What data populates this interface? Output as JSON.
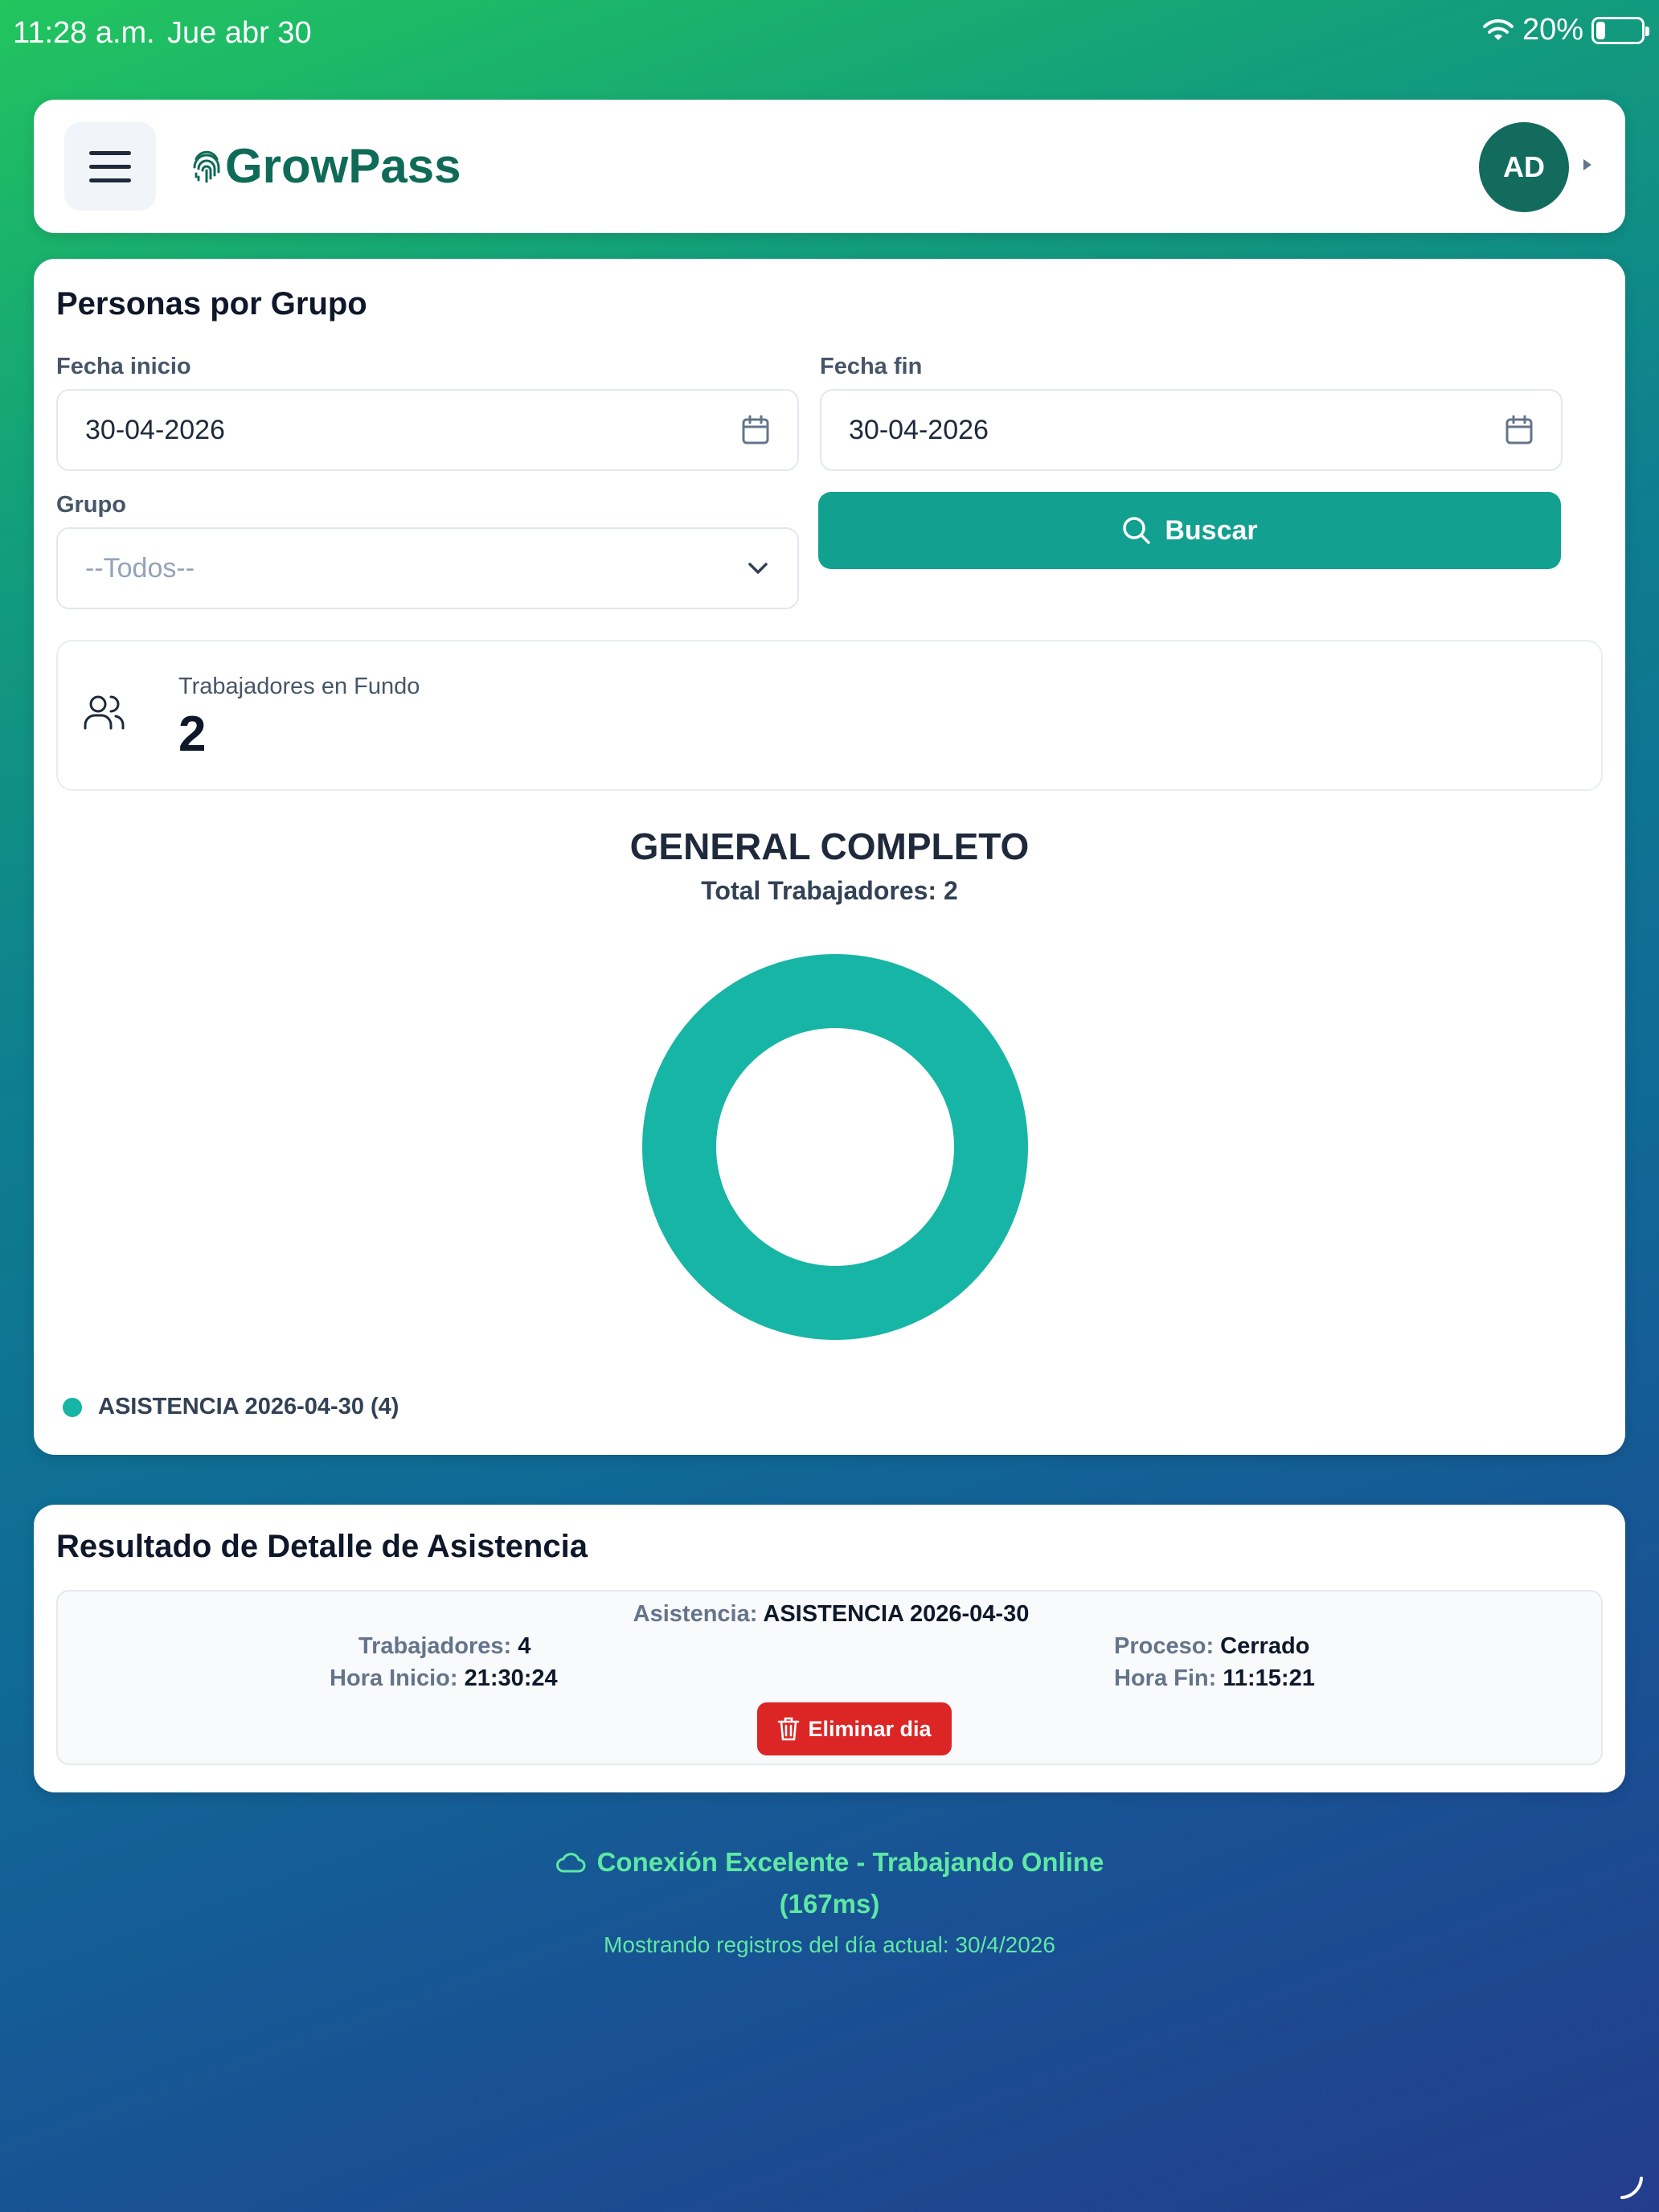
{
  "status_bar": {
    "time": "11:28 a.m.",
    "date": "Jue abr 30",
    "battery_percent": "20%",
    "battery_level": 0.2
  },
  "navbar": {
    "brand": "GrowPass",
    "avatar_initials": "AD",
    "brand_color": "#0f6b57"
  },
  "filters": {
    "title": "Personas por Grupo",
    "start_label": "Fecha inicio",
    "start_value": "30-04-2026",
    "end_label": "Fecha fin",
    "end_value": "30-04-2026",
    "group_label": "Grupo",
    "group_value": "--Todos--",
    "search_label": "Buscar"
  },
  "stat": {
    "label": "Trabajadores en Fundo",
    "value": "2"
  },
  "chart_data": {
    "type": "pie",
    "title": "GENERAL COMPLETO",
    "subtitle": "Total Trabajadores: 2",
    "categories": [
      "ASISTENCIA 2026-04-30"
    ],
    "values": [
      4
    ],
    "colors": [
      "#17b5a5"
    ],
    "donut": true,
    "legend_position": "bottom-left",
    "legend_labels": [
      "ASISTENCIA 2026-04-30 (4)"
    ]
  },
  "detail": {
    "title": "Resultado de Detalle de Asistencia",
    "asistencia_key": "Asistencia:",
    "asistencia_val": "ASISTENCIA 2026-04-30",
    "trabajadores_key": "Trabajadores:",
    "trabajadores_val": "4",
    "hora_inicio_key": "Hora Inicio:",
    "hora_inicio_val": "21:30:24",
    "proceso_key": "Proceso:",
    "proceso_val": "Cerrado",
    "hora_fin_key": "Hora Fin:",
    "hora_fin_val": "11:15:21",
    "delete_label": "Eliminar dia"
  },
  "connection": {
    "status": "Conexión Excelente - Trabajando Online",
    "latency": "(167ms)",
    "note": "Mostrando registros del día actual: 30/4/2026",
    "color": "#5ee8a4"
  }
}
